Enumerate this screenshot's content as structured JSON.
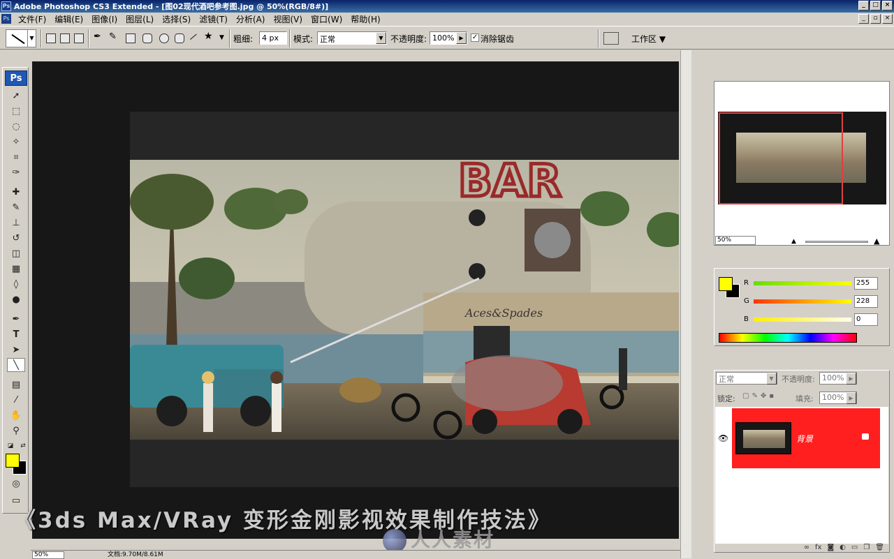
{
  "window": {
    "title": "Adobe Photoshop CS3 Extended - [图02现代酒吧参考图.jpg @ 50%(RGB/8#)]"
  },
  "menu": {
    "items": [
      "文件(F)",
      "编辑(E)",
      "图像(I)",
      "图层(L)",
      "选择(S)",
      "滤镜(T)",
      "分析(A)",
      "视图(V)",
      "窗口(W)",
      "帮助(H)"
    ]
  },
  "options": {
    "weight_label": "粗细:",
    "weight_value": "4 px",
    "mode_label": "模式:",
    "mode_value": "正常",
    "opacity_label": "不透明度:",
    "opacity_value": "100%",
    "antialias_label": "消除锯齿",
    "antialias_checked": "✓",
    "workspace_label": "工作区 ▼"
  },
  "toolbox": {
    "logo": "Ps"
  },
  "photo": {
    "sign_text": "BAR",
    "caption_text": "Aces&Spades"
  },
  "watermark": {
    "course": "《3ds Max/VRay 变形金刚影视效果制作技法》",
    "site": "人人素材"
  },
  "status": {
    "zoom": "50%",
    "doc_size": "文档:9.70M/8.61M"
  },
  "navigator": {
    "zoom": "50%"
  },
  "color_panel": {
    "r_label": "R",
    "r_value": "255",
    "g_label": "G",
    "g_value": "228",
    "b_label": "B",
    "b_value": "0",
    "foreground": "#ffff00"
  },
  "layers_panel": {
    "blend_mode": "正常",
    "opacity_label": "不透明度:",
    "opacity_value": "100%",
    "lock_label": "锁定:",
    "fill_label": "填充:",
    "fill_value": "100%",
    "layer_name": "背景"
  }
}
